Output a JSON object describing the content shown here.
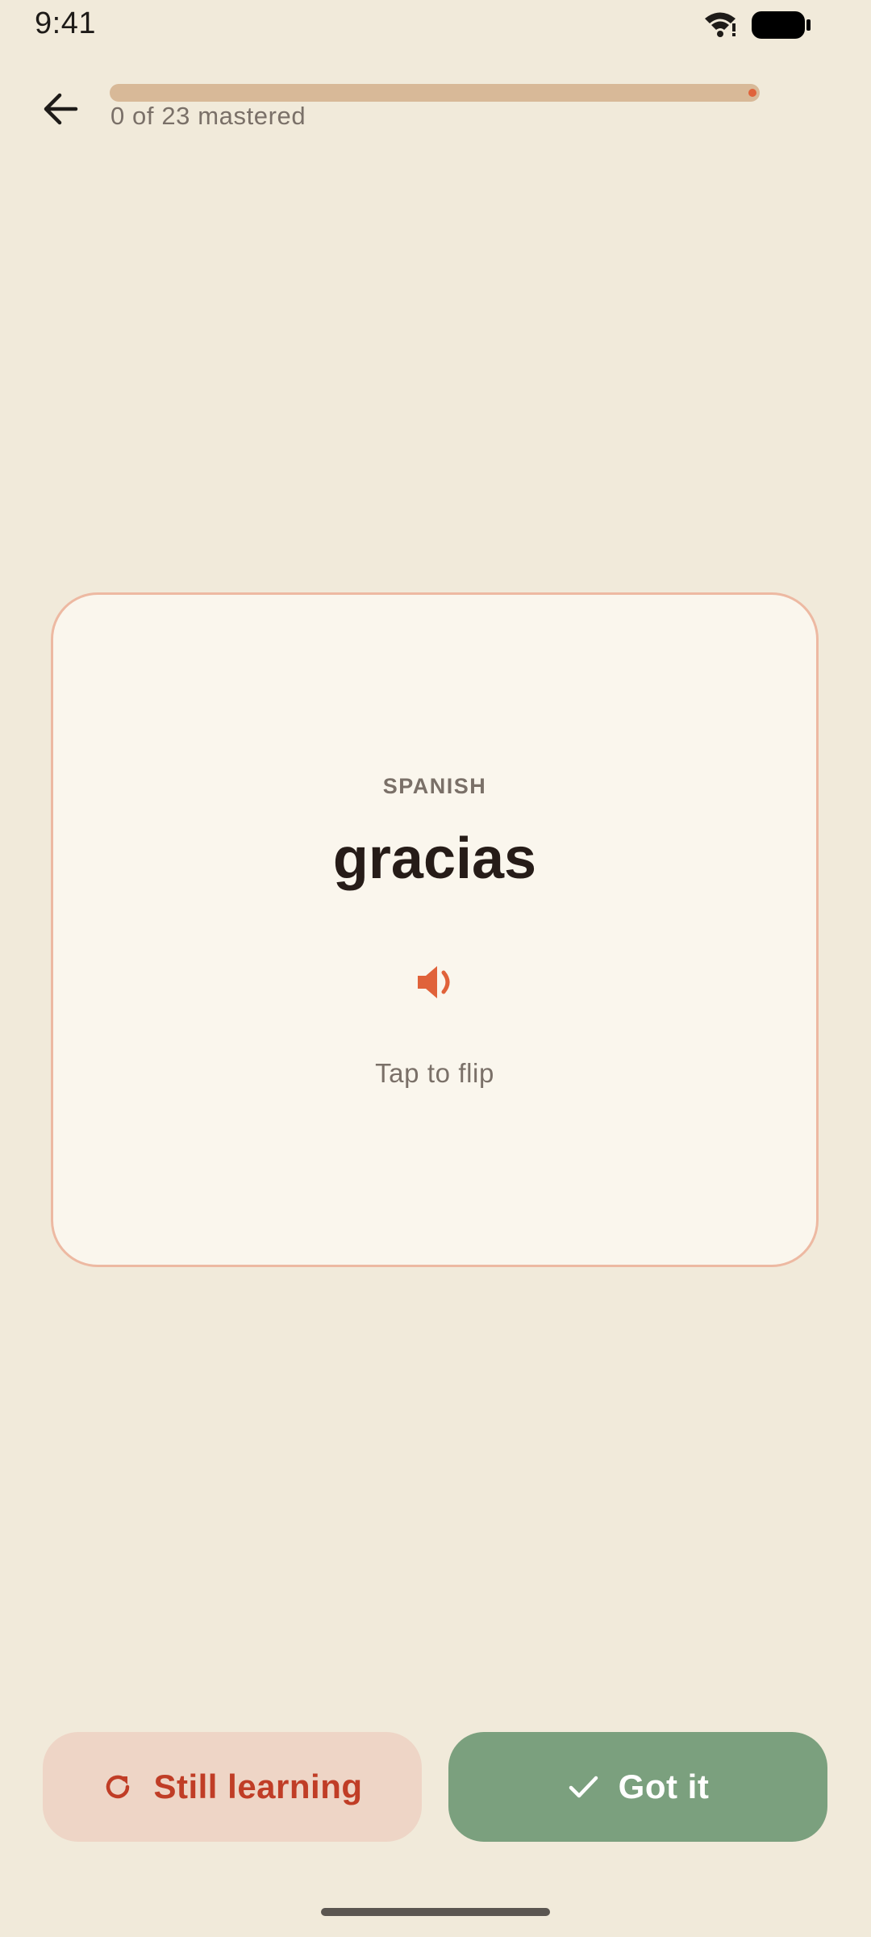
{
  "status_bar": {
    "time": "9:41",
    "icons": [
      "wifi-icon",
      "battery-icon"
    ]
  },
  "top_bar": {
    "back_icon": "arrow-left-icon",
    "progress_label": "0 of 23 mastered",
    "progress_fraction": 0.0
  },
  "card": {
    "language": "SPANISH",
    "word": "gracias",
    "speaker_icon": "speaker-icon",
    "hint": "Tap to flip"
  },
  "actions": {
    "still_learning_label": "Still learning",
    "still_learning_icon": "refresh-icon",
    "got_it_label": "Got it",
    "got_it_icon": "check-icon"
  },
  "colors": {
    "background": "#F1EADA",
    "accent": "#E0623A",
    "still_learning_bg": "#EED5C6",
    "still_learning_text": "#C03D26",
    "got_it_bg": "#7BA07E"
  }
}
